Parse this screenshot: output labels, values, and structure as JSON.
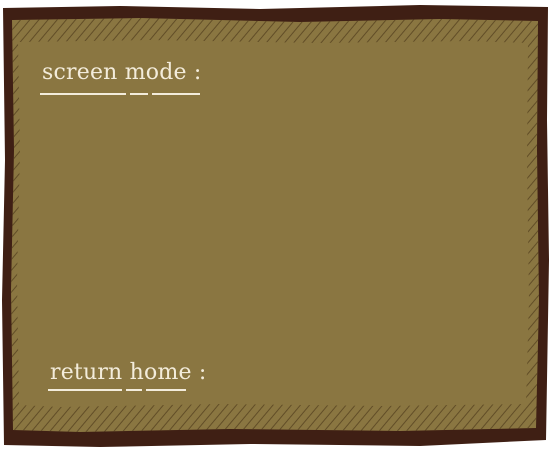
{
  "settings_panel": {
    "screen_mode_label": "screen mode :",
    "return_home_label": "return home :"
  },
  "colors": {
    "panel_fill": "#8a7641",
    "frame_border": "#3f1f14",
    "text": "#f3ecdb",
    "hatch": "#5a4622"
  }
}
